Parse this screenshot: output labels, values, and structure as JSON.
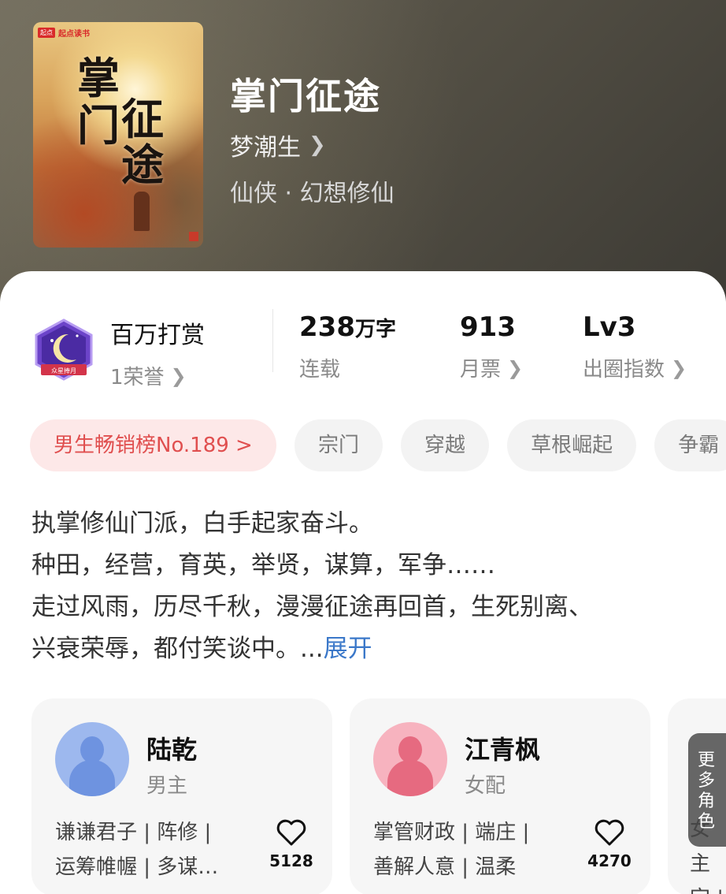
{
  "book": {
    "title": "掌门征途",
    "author": "梦潮生",
    "genre": "仙侠 · 幻想修仙",
    "cover_brand_badge": "起点",
    "cover_brand": "起点读书",
    "cover_title_chars": [
      "掌",
      "门",
      "征",
      "途"
    ]
  },
  "stats": {
    "honor_title": "百万打赏",
    "honor_sub": "1荣誉",
    "honor_badge_text": "众星捧月",
    "words_value": "238",
    "words_unit": "万字",
    "words_sub": "连载",
    "tickets_value": "913",
    "tickets_sub": "月票",
    "level_value": "Lv3",
    "level_sub": "出圈指数"
  },
  "tags": [
    "男生畅销榜No.189 >",
    "宗门",
    "穿越",
    "草根崛起",
    "争霸"
  ],
  "description": {
    "lines": [
      "执掌修仙门派，白手起家奋斗。",
      "种田，经营，育英，举贤，谋算，军争……",
      "走过风雨，历尽千秋，漫漫征途再回首，生死别离、",
      "兴衰荣辱，都付笑谈中。..."
    ],
    "expand": "展开"
  },
  "characters": [
    {
      "name": "陆乾",
      "role": "男主",
      "traits_line1": "谦谦君子 | 阵修 |",
      "traits_line2": "运筹帷幄 | 多谋…",
      "likes": "5128"
    },
    {
      "name": "江青枫",
      "role": "女配",
      "traits_line1": "掌管财政 | 端庄 |",
      "traits_line2": "善解人意 | 温柔",
      "likes": "4270"
    }
  ],
  "more_roles": [
    "更",
    "多",
    "角",
    "色"
  ],
  "peek": {
    "line1": "女主",
    "line2": "定 |"
  },
  "colors": {
    "rank_tag_bg": "#fde8e8",
    "rank_tag_text": "#e04f4f",
    "expand_link": "#3b78c9"
  },
  "icons": {
    "badge": "crescent-moon-badge-icon",
    "chevron": "chevron-right-icon",
    "like": "heart-outline-icon"
  }
}
